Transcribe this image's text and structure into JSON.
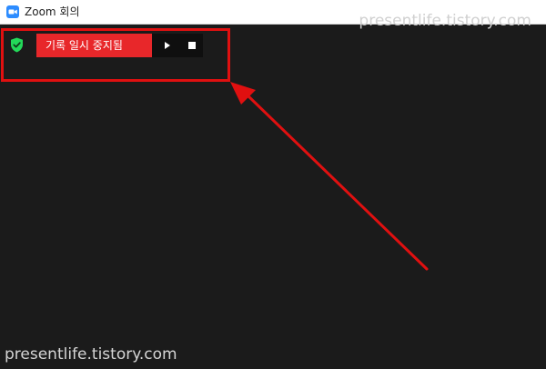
{
  "window": {
    "title": "Zoom 회의",
    "app_icon": "zoom-video-camera-icon"
  },
  "watermarks": {
    "top": "presentlife.tistory.com",
    "bottom": "presentlife.tistory.com"
  },
  "recording": {
    "status_label": "기록 일시 중지됨",
    "resume_icon": "play-icon",
    "stop_icon": "stop-icon",
    "security_icon": "shield-check-icon"
  },
  "annotation": {
    "box_color": "#e01010",
    "arrow_color": "#e01010"
  },
  "colors": {
    "meeting_background": "#1b1b1b",
    "status_red": "#e8272a",
    "shield_green": "#23d959",
    "zoom_blue": "#2d8cff"
  }
}
